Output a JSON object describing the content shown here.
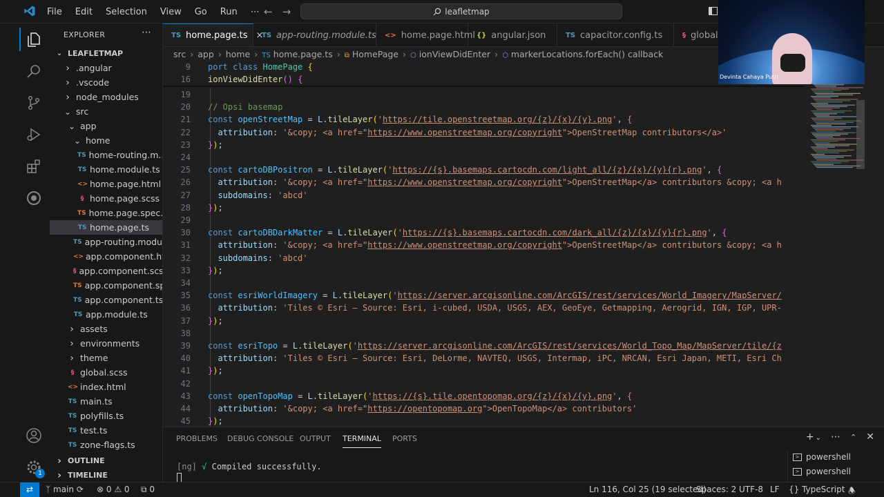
{
  "titlebar": {
    "menu": [
      "File",
      "Edit",
      "Selection",
      "View",
      "Go",
      "Run",
      "⋯"
    ],
    "search": "leafletmap"
  },
  "explorer": {
    "title": "EXPLORER",
    "root": "LEAFLETMAP",
    "items": [
      {
        "label": ".angular",
        "type": "folder",
        "depth": 1,
        "open": false
      },
      {
        "label": ".vscode",
        "type": "folder",
        "depth": 1,
        "open": false
      },
      {
        "label": "node_modules",
        "type": "folder",
        "depth": 1,
        "open": false
      },
      {
        "label": "src",
        "type": "folder",
        "depth": 1,
        "open": true
      },
      {
        "label": "app",
        "type": "folder",
        "depth": 2,
        "open": true
      },
      {
        "label": "home",
        "type": "folder",
        "depth": 3,
        "open": true
      },
      {
        "label": "home-routing.m...",
        "type": "ts",
        "depth": 4
      },
      {
        "label": "home.module.ts",
        "type": "ts",
        "depth": 4
      },
      {
        "label": "home.page.html",
        "type": "html",
        "depth": 4
      },
      {
        "label": "home.page.scss",
        "type": "scss",
        "depth": 4
      },
      {
        "label": "home.page.spec.ts",
        "type": "spec",
        "depth": 4
      },
      {
        "label": "home.page.ts",
        "type": "ts",
        "depth": 4,
        "selected": true
      },
      {
        "label": "app-routing.modul...",
        "type": "ts",
        "depth": 3
      },
      {
        "label": "app.component.ht...",
        "type": "html",
        "depth": 3
      },
      {
        "label": "app.component.scss",
        "type": "scss",
        "depth": 3
      },
      {
        "label": "app.component.sp...",
        "type": "spec",
        "depth": 3
      },
      {
        "label": "app.component.ts",
        "type": "ts",
        "depth": 3
      },
      {
        "label": "app.module.ts",
        "type": "ts",
        "depth": 3
      },
      {
        "label": "assets",
        "type": "folder",
        "depth": 2,
        "open": false
      },
      {
        "label": "environments",
        "type": "folder",
        "depth": 2,
        "open": false
      },
      {
        "label": "theme",
        "type": "folder",
        "depth": 2,
        "open": false
      },
      {
        "label": "global.scss",
        "type": "scss",
        "depth": 2
      },
      {
        "label": "index.html",
        "type": "html",
        "depth": 2
      },
      {
        "label": "main.ts",
        "type": "ts",
        "depth": 2
      },
      {
        "label": "polyfills.ts",
        "type": "ts",
        "depth": 2
      },
      {
        "label": "test.ts",
        "type": "ts",
        "depth": 2
      },
      {
        "label": "zone-flags.ts",
        "type": "ts",
        "depth": 2
      }
    ],
    "outline": "OUTLINE",
    "timeline": "TIMELINE"
  },
  "activity": {
    "accounts_badge": "1"
  },
  "tabs": [
    {
      "label": "home.page.ts",
      "icon": "TS",
      "kind": "ts",
      "active": true,
      "close": "×"
    },
    {
      "label": "app-routing.module.ts",
      "icon": "TS",
      "kind": "ts",
      "italic": true
    },
    {
      "label": "home.page.html",
      "icon": "<>",
      "kind": "html"
    },
    {
      "label": "angular.json",
      "icon": "{}",
      "kind": "json"
    },
    {
      "label": "capacitor.config.ts",
      "icon": "TS",
      "kind": "ts"
    },
    {
      "label": "global",
      "icon": "§",
      "kind": "scss"
    }
  ],
  "breadcrumb": [
    {
      "label": "src"
    },
    {
      "label": "app"
    },
    {
      "label": "home"
    },
    {
      "label": "home.page.ts",
      "icon": "TS"
    },
    {
      "label": "HomePage",
      "icon": "⧉"
    },
    {
      "label": "ionViewDidEnter",
      "icon": "⬡"
    },
    {
      "label": "markerLocations.forEach() callback",
      "icon": "⬡"
    }
  ],
  "editor": {
    "sticky": [
      {
        "ln": "9",
        "tokens": [
          [
            "k",
            "port "
          ],
          [
            "k",
            "class "
          ],
          [
            "cl",
            "HomePage "
          ],
          [
            "br1",
            "{"
          ]
        ]
      },
      {
        "ln": "16",
        "tokens": [
          [
            "fn",
            "ionViewDidEnter"
          ],
          [
            "br2",
            "()"
          ],
          [
            "p",
            " "
          ],
          [
            "br2",
            "{"
          ]
        ]
      }
    ],
    "lines": [
      {
        "ln": "19",
        "tokens": []
      },
      {
        "ln": "20",
        "tokens": [
          [
            "c",
            "// Opsi basemap"
          ]
        ]
      },
      {
        "ln": "21",
        "tokens": [
          [
            "k",
            "const "
          ],
          [
            "v",
            "openStreetMap"
          ],
          [
            "p",
            " = "
          ],
          [
            "vv",
            "L"
          ],
          [
            "p",
            "."
          ],
          [
            "fn",
            "tileLayer"
          ],
          [
            "br1",
            "("
          ],
          [
            "s",
            "'"
          ],
          [
            "u",
            "https://tile.openstreetmap.org/{z}/{x}/{y}.png"
          ],
          [
            "s",
            "'"
          ],
          [
            "p",
            ", "
          ],
          [
            "br2",
            "{"
          ]
        ]
      },
      {
        "ln": "22",
        "tokens": [
          [
            "p",
            "  "
          ],
          [
            "vv",
            "attribution"
          ],
          [
            "p",
            ": "
          ],
          [
            "s",
            "'&copy; <a href=\""
          ],
          [
            "u",
            "https://www.openstreetmap.org/copyright"
          ],
          [
            "s",
            "\">OpenStreetMap contributors</a>'"
          ]
        ]
      },
      {
        "ln": "23",
        "tokens": [
          [
            "br2",
            "}"
          ],
          [
            "br1",
            ")"
          ],
          [
            "p",
            ";"
          ]
        ]
      },
      {
        "ln": "24",
        "tokens": []
      },
      {
        "ln": "25",
        "tokens": [
          [
            "k",
            "const "
          ],
          [
            "v",
            "cartoDBPositron"
          ],
          [
            "p",
            " = "
          ],
          [
            "vv",
            "L"
          ],
          [
            "p",
            "."
          ],
          [
            "fn",
            "tileLayer"
          ],
          [
            "br1",
            "("
          ],
          [
            "s",
            "'"
          ],
          [
            "u",
            "https://{s}.basemaps.cartocdn.com/light_all/{z}/{x}/{y}{r}.png"
          ],
          [
            "s",
            "'"
          ],
          [
            "p",
            ", "
          ],
          [
            "br2",
            "{"
          ]
        ]
      },
      {
        "ln": "26",
        "tokens": [
          [
            "p",
            "  "
          ],
          [
            "vv",
            "attribution"
          ],
          [
            "p",
            ": "
          ],
          [
            "s",
            "'&copy; <a href=\""
          ],
          [
            "u",
            "https://www.openstreetmap.org/copyright"
          ],
          [
            "s",
            "\">OpenStreetMap</a> contributors &copy; <a h"
          ]
        ]
      },
      {
        "ln": "27",
        "tokens": [
          [
            "p",
            "  "
          ],
          [
            "vv",
            "subdomains"
          ],
          [
            "p",
            ": "
          ],
          [
            "s",
            "'abcd'"
          ]
        ]
      },
      {
        "ln": "28",
        "tokens": [
          [
            "br2",
            "}"
          ],
          [
            "br1",
            ")"
          ],
          [
            "p",
            ";"
          ]
        ]
      },
      {
        "ln": "29",
        "tokens": []
      },
      {
        "ln": "30",
        "tokens": [
          [
            "k",
            "const "
          ],
          [
            "v",
            "cartoDBDarkMatter"
          ],
          [
            "p",
            " = "
          ],
          [
            "vv",
            "L"
          ],
          [
            "p",
            "."
          ],
          [
            "fn",
            "tileLayer"
          ],
          [
            "br1",
            "("
          ],
          [
            "s",
            "'"
          ],
          [
            "u",
            "https://{s}.basemaps.cartocdn.com/dark_all/{z}/{x}/{y}{r}.png"
          ],
          [
            "s",
            "'"
          ],
          [
            "p",
            ", "
          ],
          [
            "br2",
            "{"
          ]
        ]
      },
      {
        "ln": "31",
        "tokens": [
          [
            "p",
            "  "
          ],
          [
            "vv",
            "attribution"
          ],
          [
            "p",
            ": "
          ],
          [
            "s",
            "'&copy; <a href=\""
          ],
          [
            "u",
            "https://www.openstreetmap.org/copyright"
          ],
          [
            "s",
            "\">OpenStreetMap</a> contributors &copy; <a h"
          ]
        ]
      },
      {
        "ln": "32",
        "tokens": [
          [
            "p",
            "  "
          ],
          [
            "vv",
            "subdomains"
          ],
          [
            "p",
            ": "
          ],
          [
            "s",
            "'abcd'"
          ]
        ]
      },
      {
        "ln": "33",
        "tokens": [
          [
            "br2",
            "}"
          ],
          [
            "br1",
            ")"
          ],
          [
            "p",
            ";"
          ]
        ]
      },
      {
        "ln": "34",
        "tokens": []
      },
      {
        "ln": "35",
        "tokens": [
          [
            "k",
            "const "
          ],
          [
            "v",
            "esriWorldImagery"
          ],
          [
            "p",
            " = "
          ],
          [
            "vv",
            "L"
          ],
          [
            "p",
            "."
          ],
          [
            "fn",
            "tileLayer"
          ],
          [
            "br1",
            "("
          ],
          [
            "s",
            "'"
          ],
          [
            "u",
            "https://server.arcgisonline.com/ArcGIS/rest/services/World_Imagery/MapServer/"
          ]
        ]
      },
      {
        "ln": "36",
        "tokens": [
          [
            "p",
            "  "
          ],
          [
            "vv",
            "attribution"
          ],
          [
            "p",
            ": "
          ],
          [
            "s",
            "'Tiles © Esri — Source: Esri, i-cubed, USDA, USGS, AEX, GeoEye, Getmapping, Aerogrid, IGN, IGP, UPR-"
          ]
        ]
      },
      {
        "ln": "37",
        "tokens": [
          [
            "br2",
            "}"
          ],
          [
            "br1",
            ")"
          ],
          [
            "p",
            ";"
          ]
        ]
      },
      {
        "ln": "38",
        "tokens": []
      },
      {
        "ln": "39",
        "tokens": [
          [
            "k",
            "const "
          ],
          [
            "v",
            "esriTopo"
          ],
          [
            "p",
            " = "
          ],
          [
            "vv",
            "L"
          ],
          [
            "p",
            "."
          ],
          [
            "fn",
            "tileLayer"
          ],
          [
            "br1",
            "("
          ],
          [
            "s",
            "'"
          ],
          [
            "u",
            "https://server.arcgisonline.com/ArcGIS/rest/services/World_Topo_Map/MapServer/tile/{z"
          ]
        ]
      },
      {
        "ln": "40",
        "tokens": [
          [
            "p",
            "  "
          ],
          [
            "vv",
            "attribution"
          ],
          [
            "p",
            ": "
          ],
          [
            "s",
            "'Tiles © Esri — Source: Esri, DeLorme, NAVTEQ, USGS, Intermap, iPC, NRCAN, Esri Japan, METI, Esri Ch"
          ]
        ]
      },
      {
        "ln": "41",
        "tokens": [
          [
            "br2",
            "}"
          ],
          [
            "br1",
            ")"
          ],
          [
            "p",
            ";"
          ]
        ]
      },
      {
        "ln": "42",
        "tokens": []
      },
      {
        "ln": "43",
        "tokens": [
          [
            "k",
            "const "
          ],
          [
            "v",
            "openTopoMap"
          ],
          [
            "p",
            " = "
          ],
          [
            "vv",
            "L"
          ],
          [
            "p",
            "."
          ],
          [
            "fn",
            "tileLayer"
          ],
          [
            "br1",
            "("
          ],
          [
            "s",
            "'"
          ],
          [
            "u",
            "https://{s}.tile.opentopomap.org/{z}/{x}/{y}.png"
          ],
          [
            "s",
            "'"
          ],
          [
            "p",
            ", "
          ],
          [
            "br2",
            "{"
          ]
        ]
      },
      {
        "ln": "44",
        "tokens": [
          [
            "p",
            "  "
          ],
          [
            "vv",
            "attribution"
          ],
          [
            "p",
            ": "
          ],
          [
            "s",
            "'&copy; <a href=\""
          ],
          [
            "u",
            "https://opentopomap.org"
          ],
          [
            "s",
            "\">OpenTopoMap</a> contributors'"
          ]
        ]
      },
      {
        "ln": "45",
        "tokens": [
          [
            "br2",
            "}"
          ],
          [
            "br1",
            ")"
          ],
          [
            "p",
            ";"
          ]
        ]
      }
    ]
  },
  "webcam": {
    "name": "Devinta Cahaya Putri"
  },
  "panel": {
    "tabs": [
      "PROBLEMS",
      "DEBUG CONSOLE",
      "OUTPUT",
      "TERMINAL",
      "PORTS"
    ],
    "active_tab": "TERMINAL",
    "terminal_prefix": "[ng]",
    "terminal_check": "√",
    "terminal_text": "Compiled successfully.",
    "shells": [
      "powershell",
      "powershell"
    ]
  },
  "statusbar": {
    "branch": "main",
    "errors": "0",
    "warnings": "0",
    "ports": "0",
    "position": "Ln 116, Col 25 (19 selected)",
    "spaces": "Spaces: 2",
    "encoding": "UTF-8",
    "eol": "LF",
    "language": "TypeScript"
  }
}
